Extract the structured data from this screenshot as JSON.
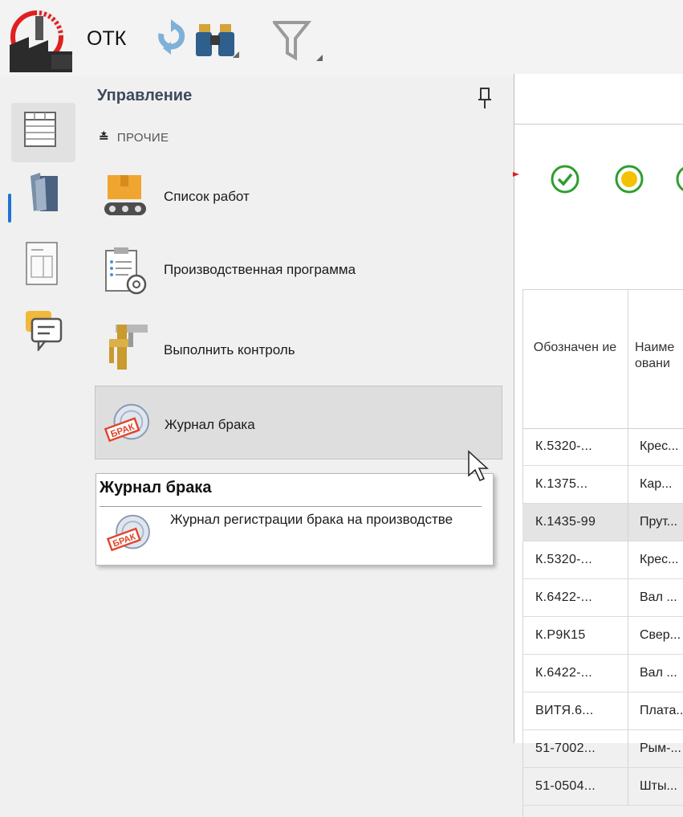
{
  "app": {
    "title": "ОТК"
  },
  "toolbar": {
    "icons": [
      "refresh-icon",
      "binoculars-icon",
      "filter-icon"
    ]
  },
  "rail": {
    "items": [
      "table-view-icon",
      "books-icon",
      "document-icon",
      "chat-icon"
    ],
    "active_index": 0
  },
  "panel": {
    "title": "Управление",
    "group": {
      "label": "ПРОЧИЕ"
    },
    "items": [
      {
        "label": "Список работ",
        "icon": "conveyor-boxes-icon"
      },
      {
        "label": "Производственная программа",
        "icon": "clipboard-gear-icon"
      },
      {
        "label": "Выполнить контроль",
        "icon": "caliper-icon"
      },
      {
        "label": "Журнал брака",
        "icon": "reject-stamp-icon"
      }
    ],
    "hovered_index": 3
  },
  "tooltip": {
    "title": "Журнал брака",
    "description": "Журнал регистрации брака на производстве",
    "stamp_text": "БРАК"
  },
  "grid": {
    "status_icons": [
      {
        "name": "check-circle-icon",
        "color": "#2e9e2e"
      },
      {
        "name": "yellow-circle-icon",
        "color": "#f2c200"
      },
      {
        "name": "green-circle-icon",
        "color": "#2e9e2e"
      }
    ],
    "columns": [
      "Обозначен ие",
      "Наиме овани"
    ],
    "rows": [
      {
        "code": "К.5320-...",
        "name": "Крес..."
      },
      {
        "code": "К.1375...",
        "name": "Кар..."
      },
      {
        "code": "К.1435-99",
        "name": "Прут..."
      },
      {
        "code": "К.5320-...",
        "name": "Крес..."
      },
      {
        "code": "К.6422-...",
        "name": "Вал ..."
      },
      {
        "code": "К.Р9К15",
        "name": "Свер..."
      },
      {
        "code": "К.6422-...",
        "name": "Вал ..."
      },
      {
        "code": "ВИТЯ.6...",
        "name": "Плата..."
      },
      {
        "code": "51-7002...",
        "name": "Рым-..."
      },
      {
        "code": "51-0504...",
        "name": "Шты..."
      }
    ],
    "selected_row_index": 2
  },
  "colors": {
    "accent": "#1e73d2",
    "hover": "#dedede",
    "selected_row": "#e4e4e4"
  }
}
